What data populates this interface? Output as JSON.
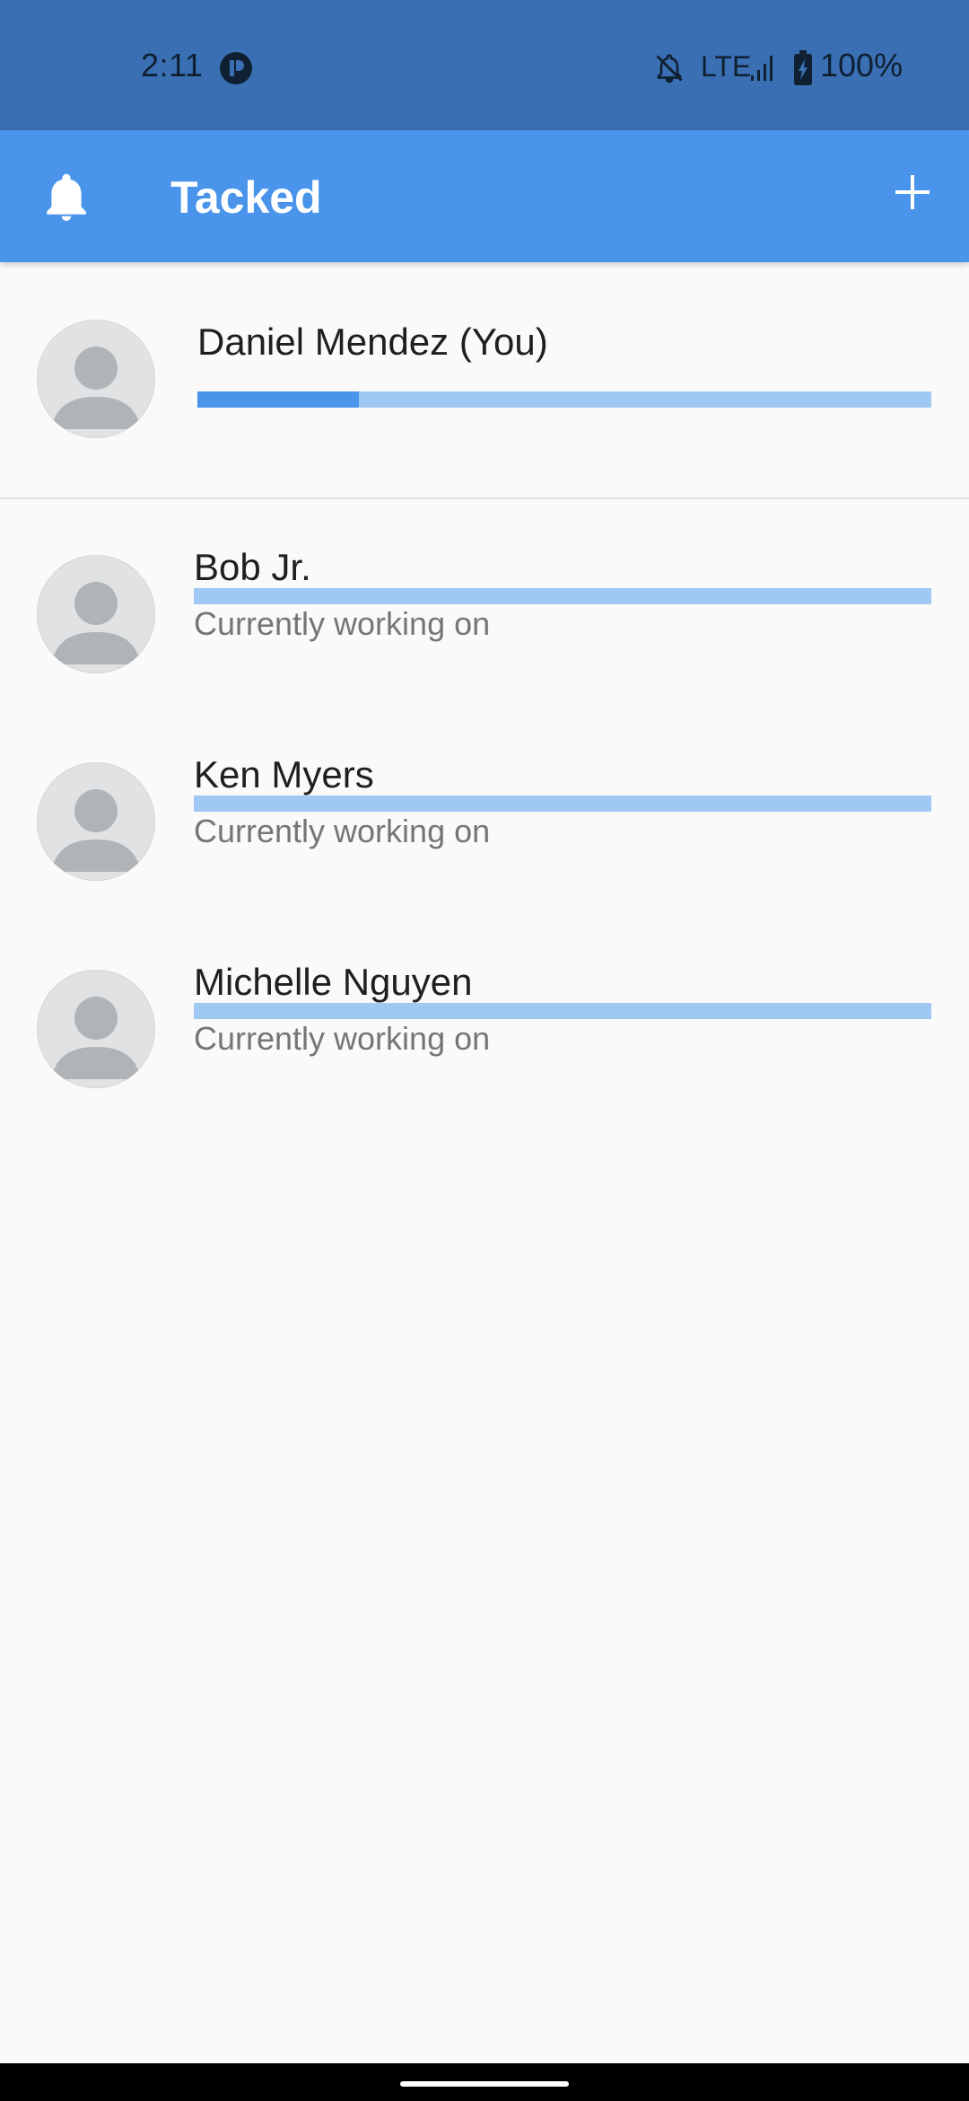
{
  "status_bar": {
    "time": "2:11",
    "network": "LTE",
    "battery": "100%"
  },
  "app_bar": {
    "title": "Tacked",
    "left_icon": "bell-icon",
    "right_icon": "plus-icon"
  },
  "current_user": {
    "name": "Daniel Mendez (You)",
    "progress": 0.22
  },
  "team": [
    {
      "name": "Bob Jr.",
      "status": "Currently working on",
      "progress": 0
    },
    {
      "name": "Ken Myers",
      "status": "Currently working on",
      "progress": 0
    },
    {
      "name": "Michelle Nguyen",
      "status": "Currently working on",
      "progress": 0
    }
  ],
  "colors": {
    "status_bar": "#3a70b3",
    "app_bar": "#4a95eb",
    "progress_fill": "#4a95eb",
    "progress_track": "#9fc9f2",
    "background": "#fafafa"
  }
}
